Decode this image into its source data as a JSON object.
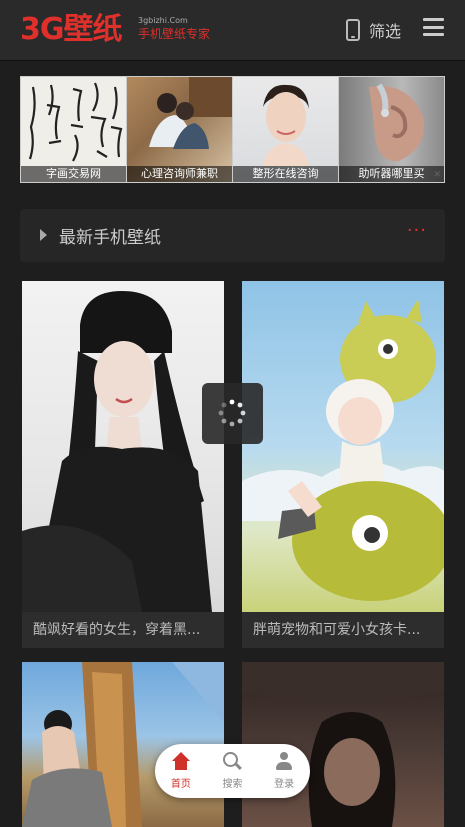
{
  "header": {
    "logo_main": "3G壁纸",
    "logo_domain": "3gbizhi.Com",
    "logo_slogan": "手机壁纸专家",
    "filter_label": "筛选"
  },
  "banner": {
    "items": [
      {
        "caption": "字画交易网"
      },
      {
        "caption": "心理咨询师兼职"
      },
      {
        "caption": "整形在线咨询"
      },
      {
        "caption": "助听器哪里买"
      }
    ],
    "close": "✕"
  },
  "section": {
    "title": "最新手机壁纸",
    "more": "···"
  },
  "cards": [
    {
      "caption": "酷飒好看的女生，穿着黑..."
    },
    {
      "caption": "胖萌宠物和可爱小女孩卡..."
    }
  ],
  "bottom_nav": {
    "items": [
      {
        "label": "首页"
      },
      {
        "label": "搜索"
      },
      {
        "label": "登录"
      }
    ]
  },
  "colors": {
    "accent": "#e0302b",
    "background": "#1e1e1e"
  }
}
